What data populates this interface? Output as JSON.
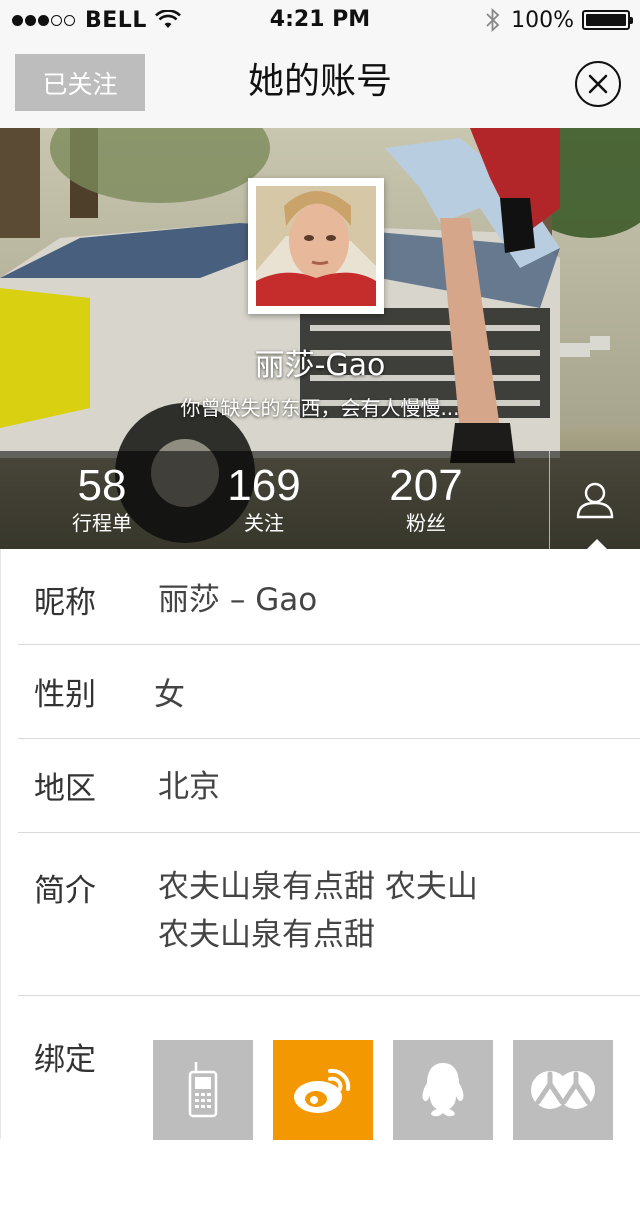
{
  "status_bar": {
    "carrier": "BELL",
    "time": "4:21 PM",
    "battery": "100%",
    "battery_level": 1.0
  },
  "nav": {
    "follow_label": "已关注",
    "title": "她的账号"
  },
  "profile": {
    "name": "丽莎-Gao",
    "bio": "你曾缺失的东西，会有人慢慢..."
  },
  "stats": [
    {
      "value": "58",
      "label": "行程单"
    },
    {
      "value": "169",
      "label": "关注"
    },
    {
      "value": "207",
      "label": "粉丝"
    }
  ],
  "info": {
    "nickname_label": "昵称",
    "nickname_value": "丽莎 – Gao",
    "gender_label": "性别",
    "gender_value": "女",
    "region_label": "地区",
    "region_value": "北京",
    "intro_label": "简介",
    "intro_line1": "农夫山泉有点甜 农夫山",
    "intro_line2": "农夫山泉有点甜",
    "bind_label": "绑定"
  },
  "bindings": [
    {
      "icon": "phone-icon",
      "active": false
    },
    {
      "icon": "weibo-icon",
      "active": true
    },
    {
      "icon": "qq-icon",
      "active": false
    },
    {
      "icon": "renren-icon",
      "active": false
    }
  ],
  "colors": {
    "inactive_bind": "#bdbdbd",
    "active_bind": "#f39800",
    "follow_button": "#bdbdbd"
  }
}
